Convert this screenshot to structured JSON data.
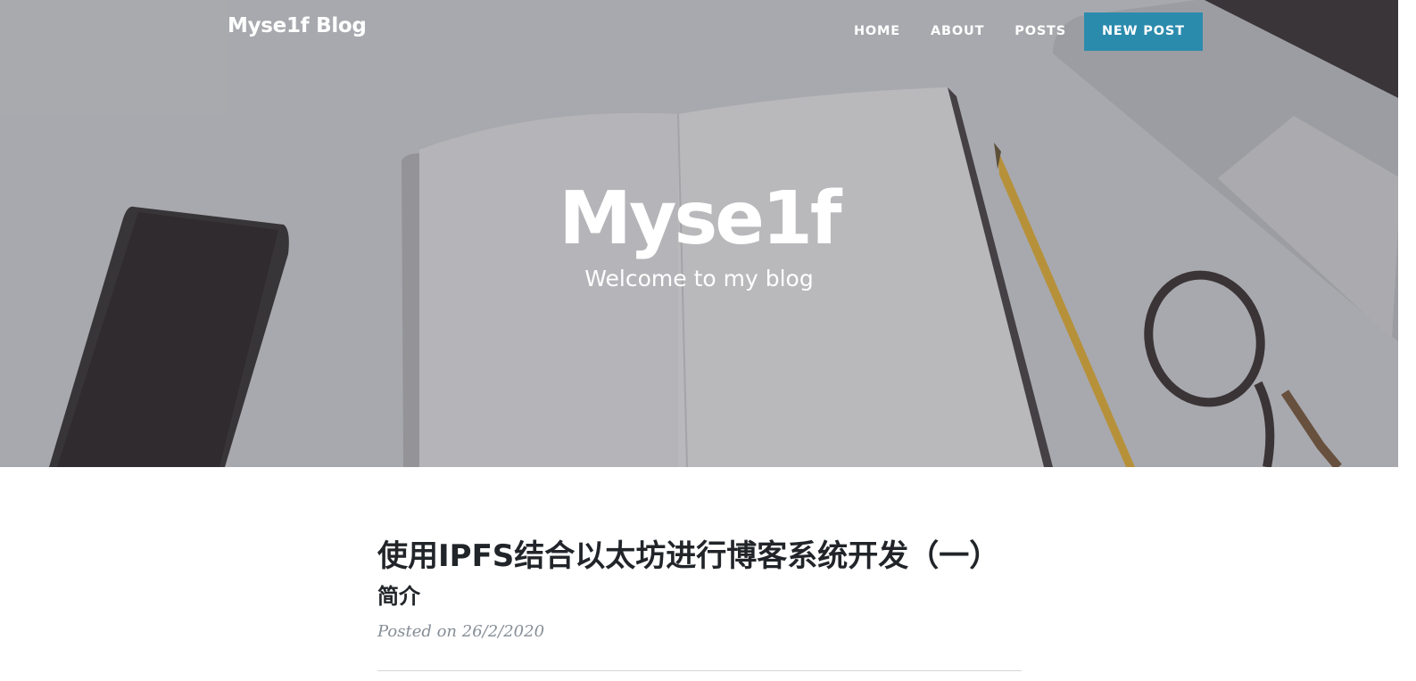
{
  "navbar": {
    "brand": "Myse1f Blog",
    "links": [
      "HOME",
      "ABOUT",
      "POSTS"
    ],
    "cta": "NEW POST"
  },
  "hero": {
    "title": "Myse1f",
    "subtitle": "Welcome to my blog"
  },
  "post": {
    "title": "使用IPFS结合以太坊进行博客系统开发（一）",
    "subtitle": "简介",
    "meta": "Posted on 26/2/2020"
  },
  "colors": {
    "accent": "#2b8bad",
    "text": "#212529",
    "meta": "#868e96"
  }
}
